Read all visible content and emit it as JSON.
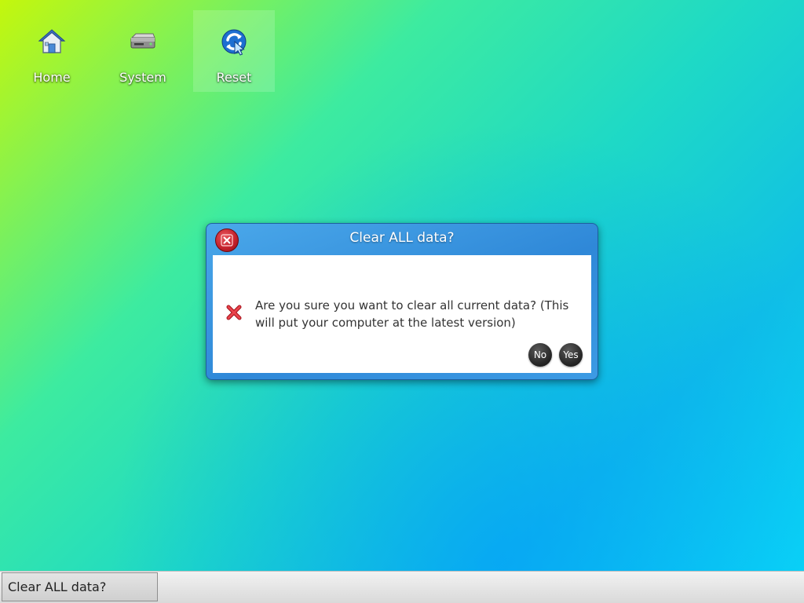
{
  "desktop": {
    "icons": [
      {
        "label": "Home",
        "icon": "home-icon"
      },
      {
        "label": "System",
        "icon": "hard-drive-icon"
      },
      {
        "label": "Reset",
        "icon": "refresh-icon",
        "selected": true
      }
    ]
  },
  "dialog": {
    "title": "Clear ALL data?",
    "close_icon": "close-icon",
    "message_icon": "error-x-icon",
    "message": "Are you sure you want to clear all current data? (This will put your computer at the latest version)",
    "buttons": {
      "no": "No",
      "yes": "Yes"
    }
  },
  "taskbar": {
    "items": [
      {
        "label": "Clear ALL data?"
      }
    ]
  },
  "colors": {
    "dialog_frame": "#2f88d8",
    "close_button": "#c2202b",
    "error_icon": "#e0323a",
    "button": "#262626"
  }
}
